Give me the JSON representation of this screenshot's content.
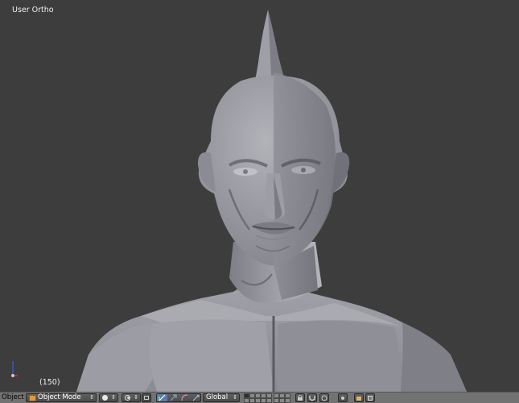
{
  "viewport": {
    "label": "User Ortho",
    "frame": "(150)",
    "background": "#3d3d3d",
    "model_color": "#9a9ba2",
    "axes": {
      "x_color": "#d03030",
      "z_color": "#2c5ec2"
    }
  },
  "header": {
    "menu_object": "Object",
    "mode": "Object Mode",
    "mode_icon": "object-cube-icon",
    "viewport_shading": "solid-sphere-icon",
    "pivot": "pivot-median-icon",
    "orientation": "Global",
    "manipulators": [
      {
        "name": "manipulator-toggle",
        "active": true
      },
      {
        "name": "translate",
        "active": false
      },
      {
        "name": "rotate",
        "active": false
      },
      {
        "name": "scale",
        "active": false
      }
    ],
    "layers_active": [
      0
    ]
  }
}
